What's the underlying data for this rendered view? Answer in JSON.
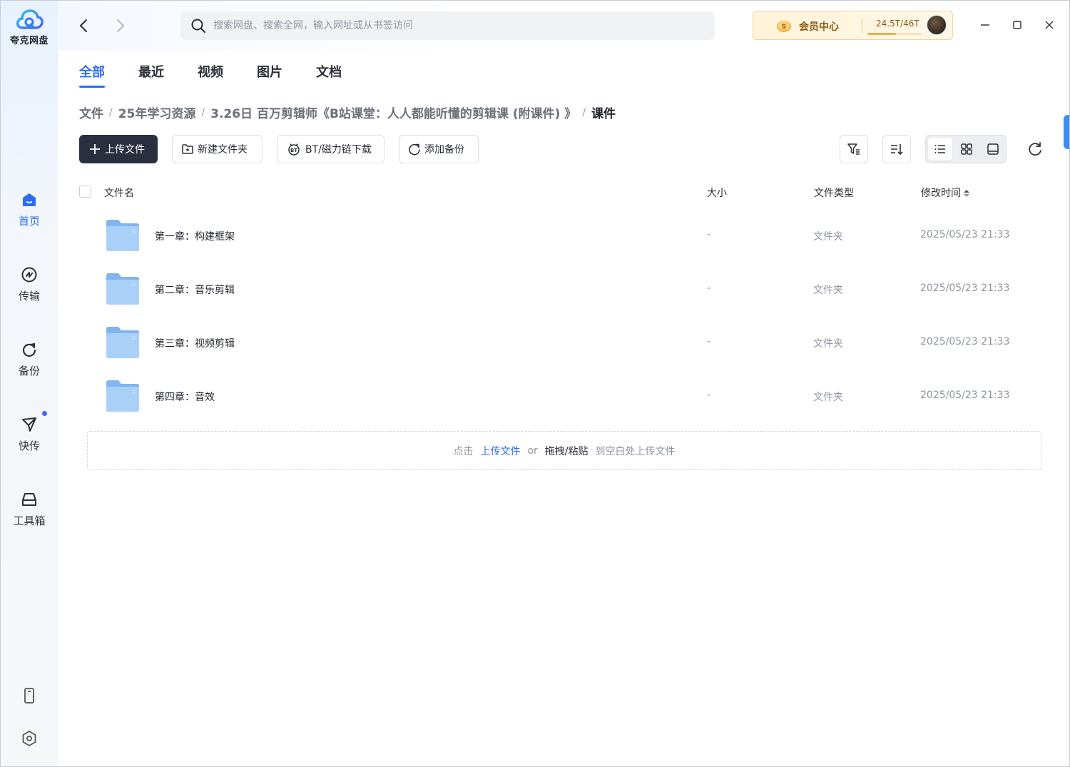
{
  "app": {
    "name": "夸克网盘",
    "accent": "#2c6cf6"
  },
  "sidebar": {
    "items": [
      {
        "label": "首页",
        "icon": "home-icon",
        "active": true
      },
      {
        "label": "传输",
        "icon": "transfer-icon",
        "active": false
      },
      {
        "label": "备份",
        "icon": "backup-icon",
        "active": false
      },
      {
        "label": "快传",
        "icon": "send-icon",
        "active": false,
        "badge_dot": true
      },
      {
        "label": "工具箱",
        "icon": "toolbox-icon",
        "active": false
      }
    ],
    "bottom_icons": [
      "mobile-icon",
      "settings-icon"
    ]
  },
  "search": {
    "placeholder": "搜索网盘、搜索全网，输入网址或从书签访问"
  },
  "vip": {
    "label": "会员中心",
    "quota": "24.5T/46T",
    "quota_fraction": 0.53
  },
  "tabs": [
    "全部",
    "最近",
    "视频",
    "图片",
    "文档"
  ],
  "breadcrumb": [
    "文件",
    "25年学习资源",
    "3.26日 百万剪辑师《B站课堂：人人都能听懂的剪辑课 (附课件) 》",
    "课件"
  ],
  "toolbar": {
    "upload": "上传文件",
    "new_folder": "新建文件夹",
    "bt": "BT/磁力链下载",
    "backup": "添加备份"
  },
  "table": {
    "headers": {
      "name": "文件名",
      "size": "大小",
      "type": "文件类型",
      "modified": "修改时间"
    },
    "rows": [
      {
        "name": "第一章：构建框架",
        "size": "-",
        "type": "文件夹",
        "modified": "2025/05/23 21:33"
      },
      {
        "name": "第二章：音乐剪辑",
        "size": "-",
        "type": "文件夹",
        "modified": "2025/05/23 21:33"
      },
      {
        "name": "第三章：视频剪辑",
        "size": "-",
        "type": "文件夹",
        "modified": "2025/05/23 21:33"
      },
      {
        "name": "第四章：音效",
        "size": "-",
        "type": "文件夹",
        "modified": "2025/05/23 21:33"
      }
    ]
  },
  "dropzone": {
    "prefix": "点击",
    "upload_link": "上传文件",
    "or": "or",
    "drag": "拖拽/粘贴",
    "suffix": "到空白处上传文件"
  }
}
